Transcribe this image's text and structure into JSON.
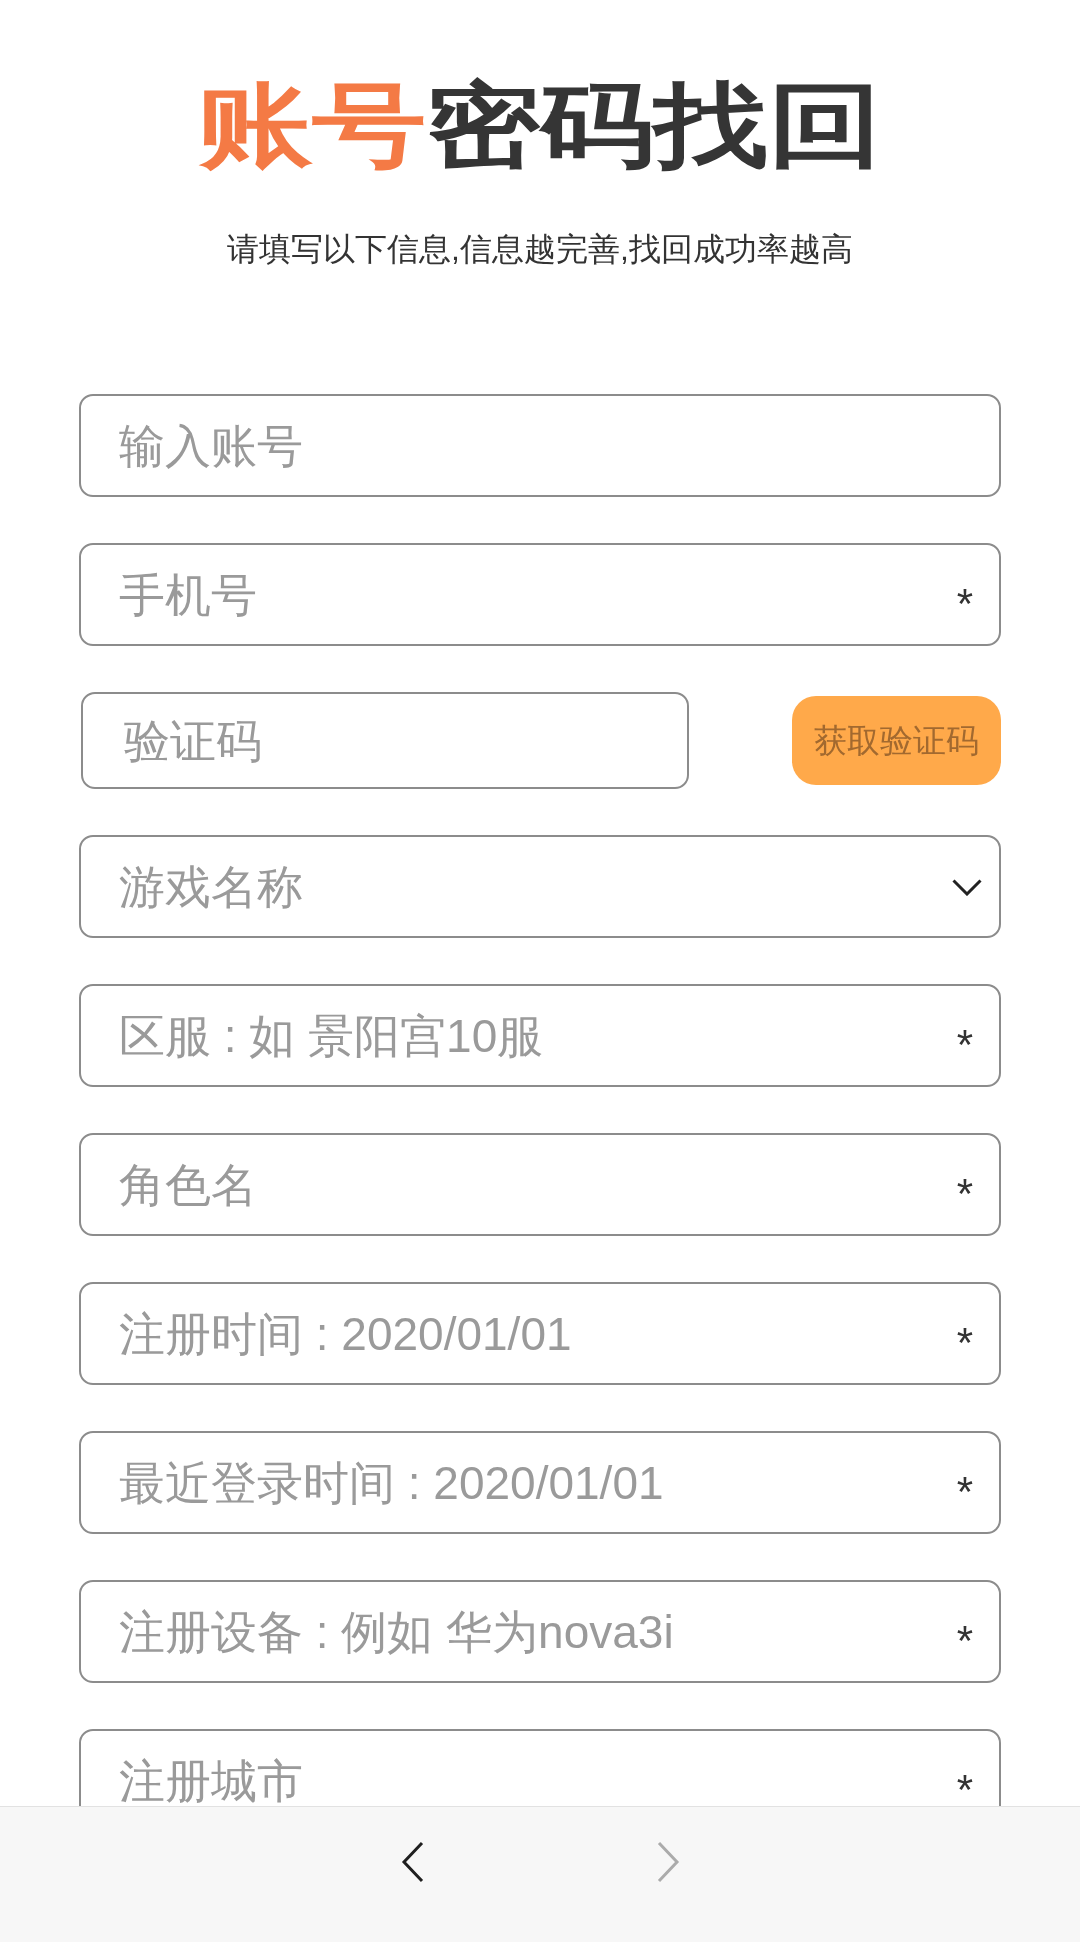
{
  "title": {
    "accent": "账号",
    "main": "密码找回"
  },
  "subtitle": "请填写以下信息,信息越完善,找回成功率越高",
  "fields": [
    {
      "kind": "text",
      "placeholder": "输入账号"
    },
    {
      "kind": "text",
      "placeholder": "手机号",
      "marker": "*"
    },
    {
      "kind": "code",
      "placeholder": "验证码",
      "button": "获取验证码"
    },
    {
      "kind": "select",
      "placeholder": "游戏名称"
    },
    {
      "kind": "text",
      "placeholder": "区服 : 如 景阳宫10服",
      "marker": "*"
    },
    {
      "kind": "text",
      "placeholder": "角色名",
      "marker": "*"
    },
    {
      "kind": "text",
      "placeholder": "注册时间 : 2020/01/01",
      "marker": "*"
    },
    {
      "kind": "text",
      "placeholder": "最近登录时间 : 2020/01/01",
      "marker": "*"
    },
    {
      "kind": "text",
      "placeholder": "注册设备 : 例如 华为nova3i",
      "marker": "*"
    },
    {
      "kind": "text",
      "placeholder": "注册城市",
      "marker": "*"
    }
  ],
  "nav": [
    {
      "kind": "back",
      "disabled": false
    },
    {
      "kind": "forward",
      "disabled": true
    }
  ]
}
